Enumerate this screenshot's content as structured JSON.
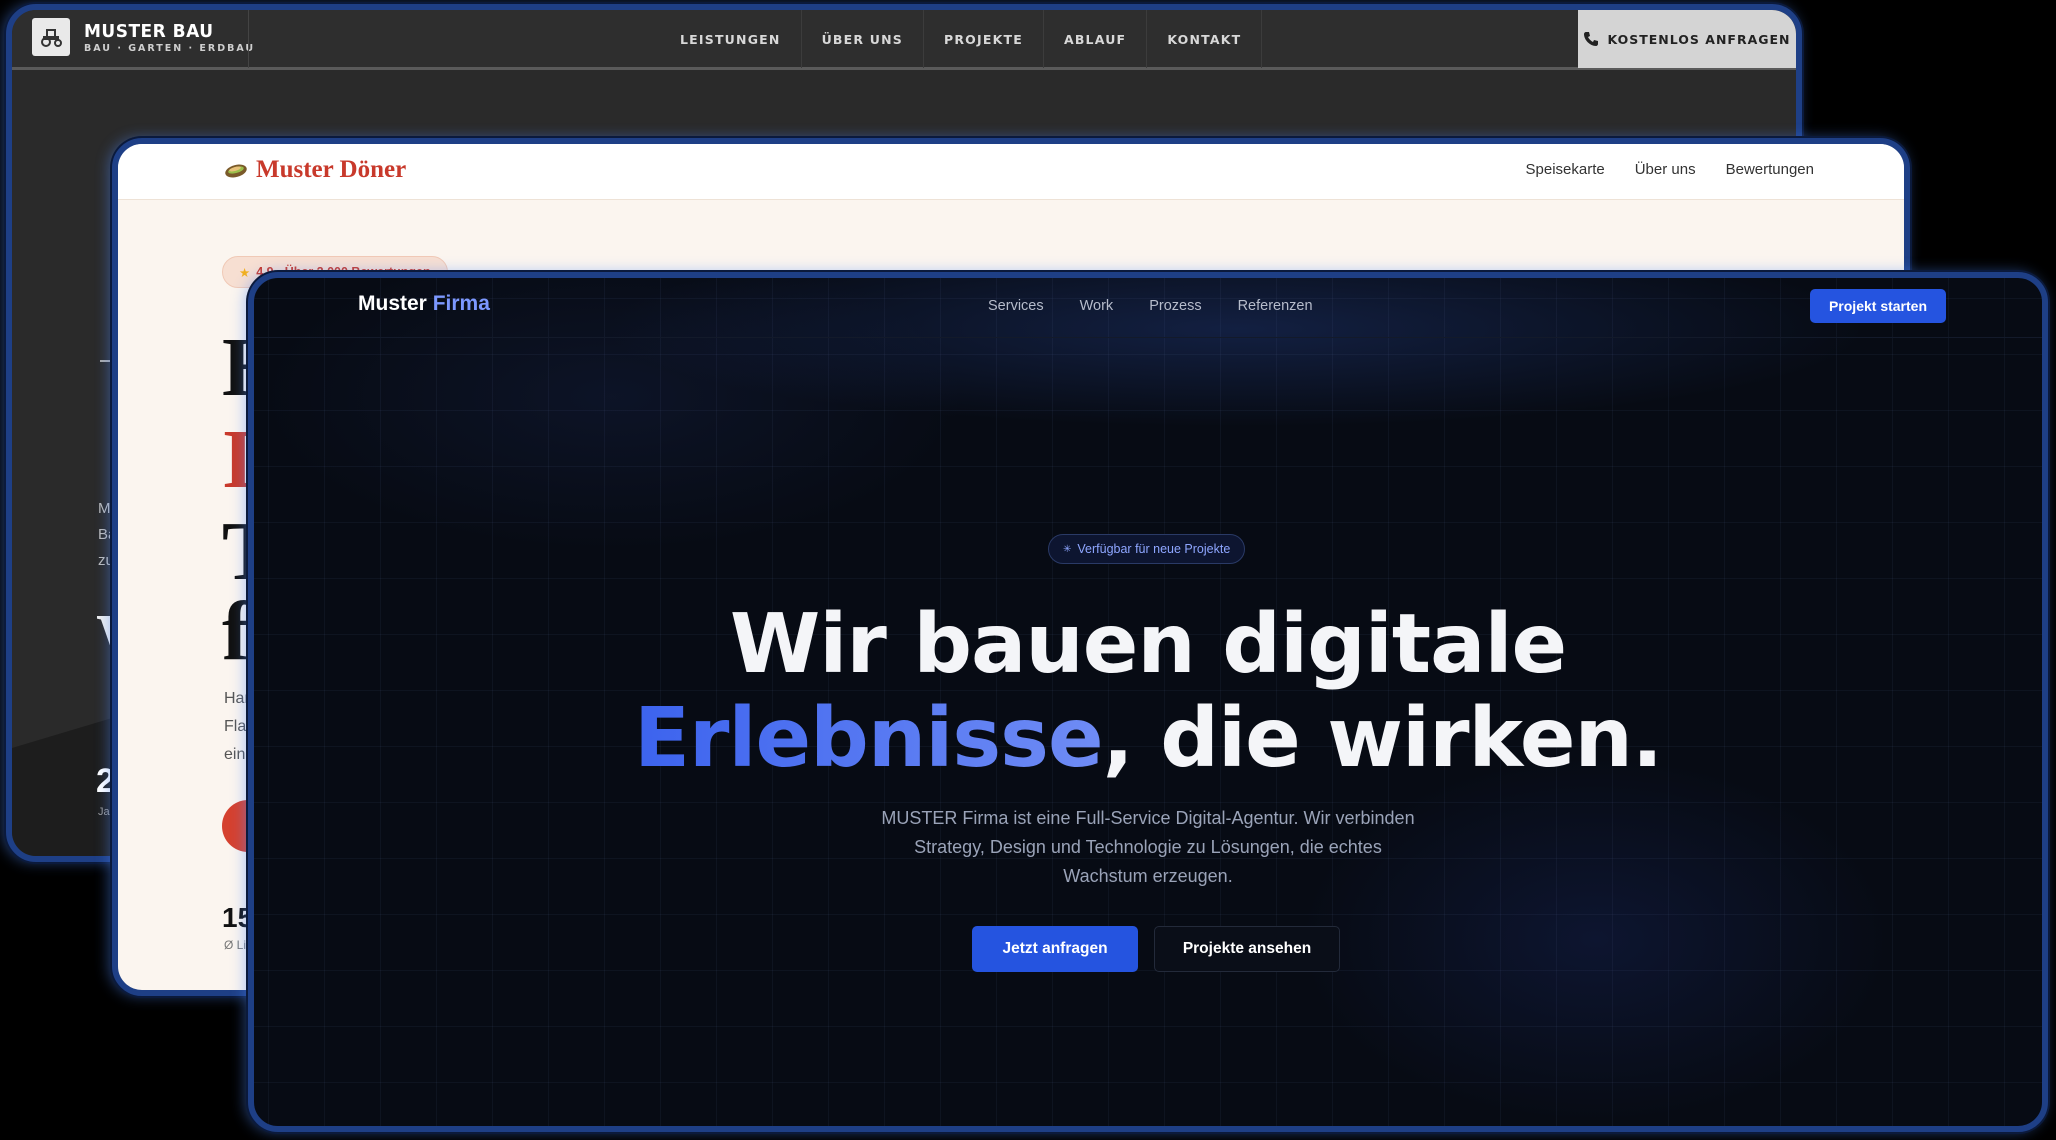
{
  "bau": {
    "brand": "MUSTER BAU",
    "brand_sub": "BAU · GARTEN · ERDBAU",
    "menu": [
      "LEISTUNGEN",
      "ÜBER UNS",
      "PROJEKTE",
      "ABLAUF",
      "KONTAKT"
    ],
    "cta": "KOSTENLOS ANFRAGEN",
    "text_lines": [
      "Mu",
      "Ba",
      "zu"
    ],
    "big_letter": "W",
    "stat": "2",
    "stat_label": "Jah"
  },
  "doener": {
    "brand": "Muster Döner",
    "links": [
      "Speisekarte",
      "Über uns",
      "Bewertungen"
    ],
    "rating_pill": "4,9 · Über 2.000 Bewertungen",
    "headline_letters": [
      "H",
      "I",
      "T",
      "f"
    ],
    "desc_lines": [
      "Han",
      "Flac",
      "ein"
    ],
    "stat": "15",
    "stat_label": "Ø Lie"
  },
  "firma": {
    "brand_main": "Muster",
    "brand_accent": "Firma",
    "links": [
      "Services",
      "Work",
      "Prozess",
      "Referenzen"
    ],
    "cta": "Projekt starten",
    "badge": "Verfügbar für neue Projekte",
    "headline_line1": "Wir bauen digitale",
    "headline_accent": "Erlebnisse",
    "headline_rest": ", die wirken.",
    "subtitle_lines": [
      "MUSTER Firma ist eine Full-Service Digital-Agentur. Wir verbinden",
      "Strategy, Design und Technologie zu Lösungen, die echtes",
      "Wachstum erzeugen."
    ],
    "primary_button": "Jetzt anfragen",
    "secondary_button": "Projekte ansehen"
  },
  "colors": {
    "firma_accent": "#2554e0",
    "doener_red": "#c8392b",
    "bau_dark": "#2a2a2a",
    "window_border": "#1e3f86"
  }
}
